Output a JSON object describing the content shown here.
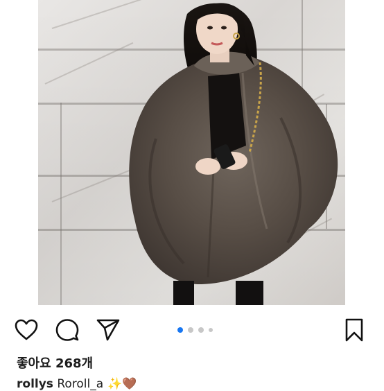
{
  "post": {
    "likes_text": "좋아요 268개",
    "caption_user": "rollys",
    "caption_text": " Roroll_a"
  },
  "carousel": {
    "total": 4,
    "active_index": 0,
    "active_color": "#1877f2",
    "inactive_color": "#c7c7c7"
  },
  "icons": {
    "like": "heart-icon",
    "comment": "comment-bubble-icon",
    "share": "paper-plane-icon",
    "save": "bookmark-icon"
  }
}
